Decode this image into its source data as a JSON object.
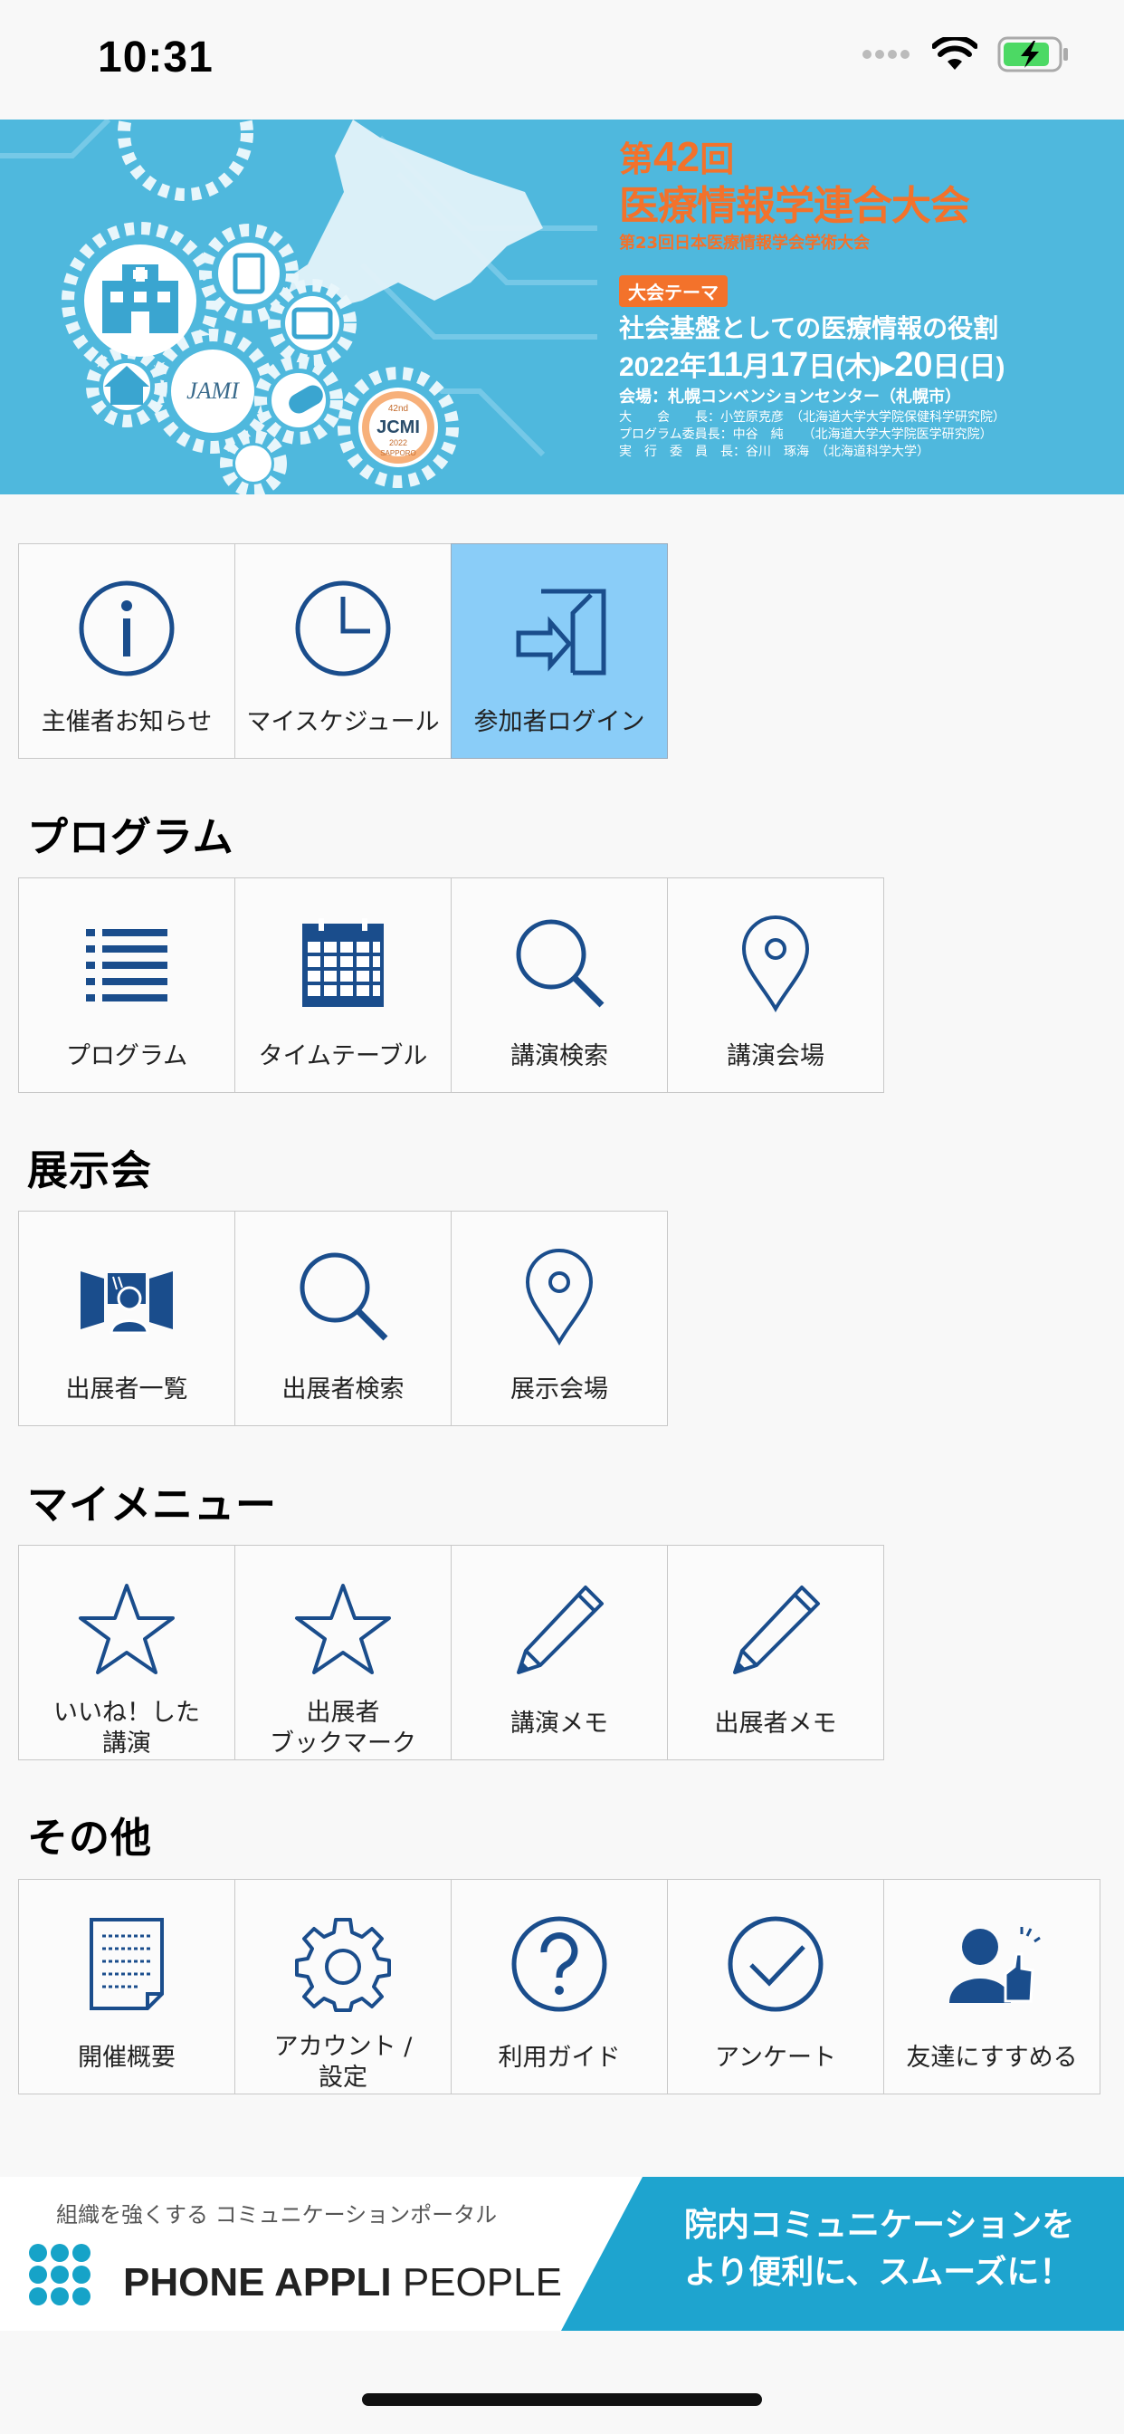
{
  "status_bar": {
    "time": "10:31",
    "icons": [
      "signal-icon",
      "wifi-icon",
      "battery-charging-icon"
    ]
  },
  "banner": {
    "edition_prefix": "第",
    "edition_number": "42",
    "edition_suffix": "回",
    "title": "医療情報学連合大会",
    "subtitle": "第23回日本医療情報学会学術大会",
    "theme_badge": "大会テーマ",
    "theme": "社会基盤としての医療情報の役割",
    "date_year": "2022年",
    "date_month": "11",
    "date_month_unit": "月",
    "date_start_day": "17",
    "date_start_unit": "日(木)",
    "date_arrow": "▸",
    "date_end_day": "20",
    "date_end_unit": "日(日)",
    "venue": "会場：札幌コンベンションセンター（札幌市）",
    "staff": [
      "大　　会　　長：小笠原克彦　（北海道大学大学院保健科学研究院）",
      "プログラム委員長：中谷　純　　（北海道大学大学院医学研究院）",
      "実　行　委　員　長：谷川　琢海　（北海道科学大学）"
    ],
    "logo_text": "JCMI",
    "logo_year": "2022",
    "logo_edition": "42nd",
    "logo_city": "SAPPORO",
    "jami_text": "JAMI"
  },
  "top_menu": {
    "items": [
      {
        "label": "主催者お知らせ",
        "icon": "info-icon"
      },
      {
        "label": "マイスケジュール",
        "icon": "clock-icon"
      },
      {
        "label": "参加者ログイン",
        "icon": "login-icon"
      }
    ]
  },
  "program": {
    "title": "プログラム",
    "items": [
      {
        "label": "プログラム",
        "icon": "list-icon"
      },
      {
        "label": "タイムテーブル",
        "icon": "calendar-icon"
      },
      {
        "label": "講演検索",
        "icon": "search-icon"
      },
      {
        "label": "講演会場",
        "icon": "map-pin-icon"
      }
    ]
  },
  "exhibition": {
    "title": "展示会",
    "items": [
      {
        "label": "出展者一覧",
        "icon": "exhibitor-icon"
      },
      {
        "label": "出展者検索",
        "icon": "search-icon"
      },
      {
        "label": "展示会場",
        "icon": "map-pin-icon"
      }
    ]
  },
  "mymenu": {
    "title": "マイメニュー",
    "items": [
      {
        "label_line1": "いいね！した",
        "label_line2": "講演",
        "icon": "star-icon"
      },
      {
        "label_line1": "出展者",
        "label_line2": "ブックマーク",
        "icon": "star-icon"
      },
      {
        "label": "講演メモ",
        "icon": "pencil-icon"
      },
      {
        "label": "出展者メモ",
        "icon": "pencil-icon"
      }
    ]
  },
  "others": {
    "title": "その他",
    "items": [
      {
        "label": "開催概要",
        "icon": "document-icon"
      },
      {
        "label_line1": "アカウント /",
        "label_line2": "設定",
        "icon": "gear-icon"
      },
      {
        "label": "利用ガイド",
        "icon": "help-icon"
      },
      {
        "label": "アンケート",
        "icon": "check-circle-icon"
      },
      {
        "label": "友達にすすめる",
        "icon": "recommend-icon"
      }
    ]
  },
  "ad": {
    "tagline": "組織を強くする コミュニケーションポータル",
    "brand_bold": "PHONE APPLI",
    "brand_light": " PEOPLE",
    "copy_line1": "院内コミュニケーションを",
    "copy_line2": "より便利に、スムーズに！"
  },
  "colors": {
    "icon_blue": "#1a4d8c",
    "active_tile": "#8acdf8",
    "banner_bg": "#4fb8dd",
    "banner_accent": "#f3722b",
    "ad_blue": "#1ea4cf"
  }
}
